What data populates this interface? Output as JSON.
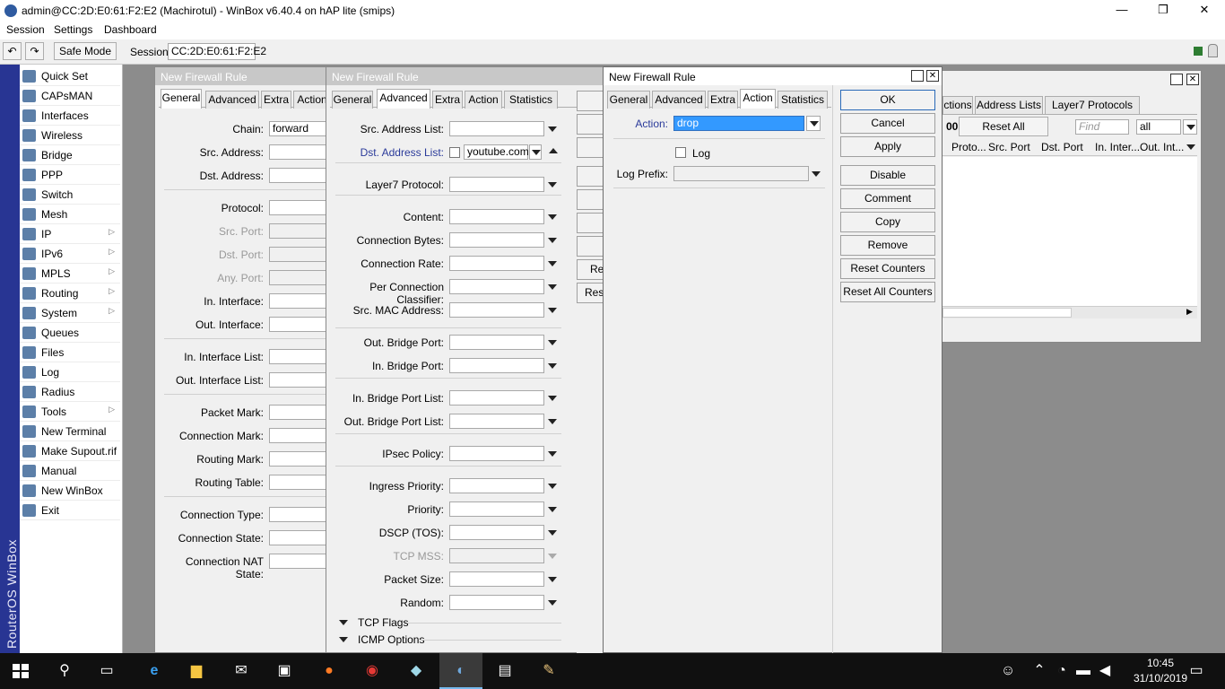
{
  "window": {
    "title": "admin@CC:2D:E0:61:F2:E2 (Machirotul) - WinBox v6.40.4 on hAP lite (smips)",
    "min": "—",
    "max": "❐",
    "close": "✕"
  },
  "menu": [
    "Session",
    "Settings",
    "Dashboard"
  ],
  "toolbar": {
    "undo": "↶",
    "redo": "↷",
    "safe_mode": "Safe Mode",
    "session_label": "Session:",
    "session_value": "CC:2D:E0:61:F2:E2"
  },
  "sidebar": {
    "brand": "RouterOS WinBox",
    "items": [
      {
        "label": "Quick Set",
        "icon": "quick-set-icon",
        "sub": false
      },
      {
        "label": "CAPsMAN",
        "icon": "capsman-icon",
        "sub": false
      },
      {
        "label": "Interfaces",
        "icon": "interfaces-icon",
        "sub": false
      },
      {
        "label": "Wireless",
        "icon": "wireless-icon",
        "sub": false
      },
      {
        "label": "Bridge",
        "icon": "bridge-icon",
        "sub": false
      },
      {
        "label": "PPP",
        "icon": "ppp-icon",
        "sub": false
      },
      {
        "label": "Switch",
        "icon": "switch-icon",
        "sub": false
      },
      {
        "label": "Mesh",
        "icon": "mesh-icon",
        "sub": false
      },
      {
        "label": "IP",
        "icon": "ip-icon",
        "sub": true
      },
      {
        "label": "IPv6",
        "icon": "ipv6-icon",
        "sub": true
      },
      {
        "label": "MPLS",
        "icon": "mpls-icon",
        "sub": true
      },
      {
        "label": "Routing",
        "icon": "routing-icon",
        "sub": true
      },
      {
        "label": "System",
        "icon": "system-icon",
        "sub": true
      },
      {
        "label": "Queues",
        "icon": "queues-icon",
        "sub": false
      },
      {
        "label": "Files",
        "icon": "files-icon",
        "sub": false
      },
      {
        "label": "Log",
        "icon": "log-icon",
        "sub": false
      },
      {
        "label": "Radius",
        "icon": "radius-icon",
        "sub": false
      },
      {
        "label": "Tools",
        "icon": "tools-icon",
        "sub": true
      },
      {
        "label": "New Terminal",
        "icon": "terminal-icon",
        "sub": false
      },
      {
        "label": "Make Supout.rif",
        "icon": "supout-icon",
        "sub": false
      },
      {
        "label": "Manual",
        "icon": "manual-icon",
        "sub": false
      },
      {
        "label": "New WinBox",
        "icon": "winbox-icon",
        "sub": false
      },
      {
        "label": "Exit",
        "icon": "exit-icon",
        "sub": false
      }
    ]
  },
  "win1": {
    "title": "New Firewall Rule",
    "tabs": [
      "General",
      "Advanced",
      "Extra",
      "Action"
    ],
    "fields": [
      {
        "label": "Chain:",
        "value": "forward",
        "dim": false
      },
      {
        "label": "Src. Address:",
        "value": "",
        "dim": false
      },
      {
        "label": "Dst. Address:",
        "value": "",
        "dim": false
      },
      {
        "label": "Protocol:",
        "value": "",
        "dim": false
      },
      {
        "label": "Src. Port:",
        "value": "",
        "dim": true
      },
      {
        "label": "Dst. Port:",
        "value": "",
        "dim": true
      },
      {
        "label": "Any. Port:",
        "value": "",
        "dim": true
      },
      {
        "label": "In. Interface:",
        "value": "",
        "dim": false
      },
      {
        "label": "Out. Interface:",
        "value": "",
        "dim": false
      },
      {
        "label": "In. Interface List:",
        "value": "",
        "dim": false
      },
      {
        "label": "Out. Interface List:",
        "value": "",
        "dim": false
      },
      {
        "label": "Packet Mark:",
        "value": "",
        "dim": false
      },
      {
        "label": "Connection Mark:",
        "value": "",
        "dim": false
      },
      {
        "label": "Routing Mark:",
        "value": "",
        "dim": false
      },
      {
        "label": "Routing Table:",
        "value": "",
        "dim": false
      },
      {
        "label": "Connection Type:",
        "value": "",
        "dim": false
      },
      {
        "label": "Connection State:",
        "value": "",
        "dim": false
      },
      {
        "label": "Connection NAT State:",
        "value": "",
        "dim": false
      }
    ]
  },
  "win2": {
    "title": "New Firewall Rule",
    "tabs": [
      "General",
      "Advanced",
      "Extra",
      "Action",
      "Statistics"
    ],
    "fields": [
      {
        "label": "Src. Address List:",
        "value": ""
      },
      {
        "label": "Dst. Address List:",
        "value": "youtube.com"
      },
      {
        "label": "Layer7 Protocol:",
        "value": ""
      },
      {
        "label": "Content:",
        "value": ""
      },
      {
        "label": "Connection Bytes:",
        "value": ""
      },
      {
        "label": "Connection Rate:",
        "value": ""
      },
      {
        "label": "Per Connection Classifier:",
        "value": ""
      },
      {
        "label": "Src. MAC Address:",
        "value": ""
      },
      {
        "label": "Out. Bridge Port:",
        "value": ""
      },
      {
        "label": "In. Bridge Port:",
        "value": ""
      },
      {
        "label": "In. Bridge Port List:",
        "value": ""
      },
      {
        "label": "Out. Bridge Port List:",
        "value": ""
      },
      {
        "label": "IPsec Policy:",
        "value": ""
      },
      {
        "label": "Ingress Priority:",
        "value": ""
      },
      {
        "label": "Priority:",
        "value": ""
      },
      {
        "label": "DSCP (TOS):",
        "value": ""
      },
      {
        "label": "TCP MSS:",
        "value": ""
      },
      {
        "label": "Packet Size:",
        "value": ""
      },
      {
        "label": "Random:",
        "value": ""
      }
    ],
    "sections": [
      "TCP Flags",
      "ICMP Options"
    ],
    "partial_buttons": [
      "Re",
      "Res"
    ]
  },
  "win3": {
    "title": "New Firewall Rule",
    "tabs": [
      "General",
      "Advanced",
      "Extra",
      "Action",
      "Statistics"
    ],
    "action_label": "Action:",
    "action_value": "drop",
    "log_label": "Log",
    "log_prefix_label": "Log Prefix:",
    "log_prefix_value": "",
    "buttons": [
      "OK",
      "Cancel",
      "Apply",
      "Disable",
      "Comment",
      "Copy",
      "Remove",
      "Reset Counters",
      "Reset All Counters"
    ]
  },
  "win4": {
    "tabs": [
      "ctions",
      "Address Lists",
      "Layer7 Protocols"
    ],
    "counter_prefix": "00",
    "reset_all": "Reset All Counters",
    "find_placeholder": "Find",
    "filter": "all",
    "columns": [
      "Proto...",
      "Src. Port",
      "Dst. Port",
      "In. Inter...",
      "Out. Int..."
    ]
  },
  "taskbar": {
    "time": "10:45",
    "date": "31/10/2019"
  }
}
